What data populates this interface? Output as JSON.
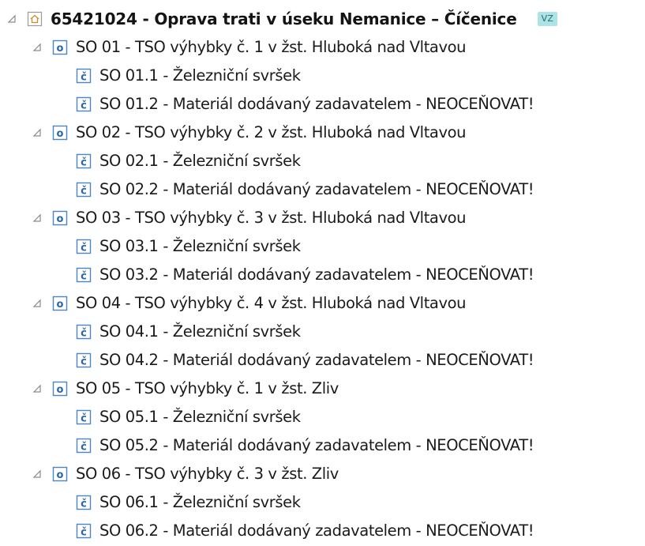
{
  "tree": {
    "root": {
      "label": "65421024 - Oprava trati v úseku Nemanice – Číčenice",
      "badge": "VZ",
      "icon": "house-icon",
      "expander": "expanded",
      "children": [
        {
          "label": "SO 01 - TSO výhybky č. 1 v žst. Hluboká nad Vltavou",
          "icon": "object-icon",
          "children": [
            {
              "label": "SO 01.1 - Železniční svršek",
              "icon": "section-icon"
            },
            {
              "label": "SO 01.2 - Materiál dodávaný zadavatelem - NEOCEŇOVAT!",
              "icon": "section-icon"
            }
          ]
        },
        {
          "label": "SO 02 - TSO výhybky č. 2 v žst. Hluboká nad Vltavou",
          "icon": "object-icon",
          "children": [
            {
              "label": "SO 02.1 - Železniční svršek",
              "icon": "section-icon"
            },
            {
              "label": "SO 02.2 - Materiál dodávaný zadavatelem - NEOCEŇOVAT!",
              "icon": "section-icon"
            }
          ]
        },
        {
          "label": "SO 03 - TSO výhybky č. 3 v žst. Hluboká nad Vltavou",
          "icon": "object-icon",
          "children": [
            {
              "label": "SO 03.1 - Železniční svršek",
              "icon": "section-icon"
            },
            {
              "label": "SO 03.2 - Materiál dodávaný zadavatelem - NEOCEŇOVAT!",
              "icon": "section-icon"
            }
          ]
        },
        {
          "label": "SO 04 - TSO výhybky č. 4 v žst. Hluboká nad Vltavou",
          "icon": "object-icon",
          "children": [
            {
              "label": "SO 04.1 - Železniční svršek",
              "icon": "section-icon"
            },
            {
              "label": "SO 04.2 - Materiál dodávaný zadavatelem - NEOCEŇOVAT!",
              "icon": "section-icon"
            }
          ]
        },
        {
          "label": "SO 05 - TSO výhybky č. 1 v žst. Zliv",
          "icon": "object-icon",
          "children": [
            {
              "label": "SO 05.1 - Železniční svršek",
              "icon": "section-icon"
            },
            {
              "label": "SO 05.2 - Materiál dodávaný zadavatelem - NEOCEŇOVAT!",
              "icon": "section-icon"
            }
          ]
        },
        {
          "label": "SO 06 - TSO výhybky č. 3 v žst. Zliv",
          "icon": "object-icon",
          "children": [
            {
              "label": "SO 06.1 - Železniční svršek",
              "icon": "section-icon"
            },
            {
              "label": "SO 06.2 - Materiál dodávaný zadavatelem - NEOCEŇOVAT!",
              "icon": "section-icon"
            }
          ]
        }
      ]
    }
  },
  "colors": {
    "icon_border": "#4a86c5",
    "icon_glyph": "#2a66a8",
    "badge_bg": "#aee3e3",
    "badge_text": "#1f6f78",
    "expander": "#8a8a8a"
  }
}
